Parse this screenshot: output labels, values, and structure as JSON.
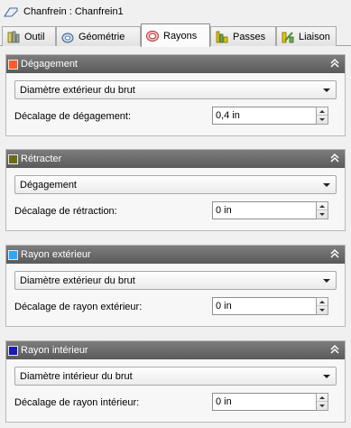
{
  "window": {
    "title": "Chanfrein : Chanfrein1",
    "icon": "chamfer-operation-icon"
  },
  "tabs": [
    {
      "label": "Outil",
      "icon": "tool-icon",
      "active": false
    },
    {
      "label": "Géométrie",
      "icon": "geometry-icon",
      "active": false
    },
    {
      "label": "Rayons",
      "icon": "radii-icon",
      "active": true
    },
    {
      "label": "Passes",
      "icon": "passes-icon",
      "active": false
    },
    {
      "label": "Liaison",
      "icon": "linking-icon",
      "active": false
    }
  ],
  "panels": [
    {
      "title": "Dégagement",
      "color": "#ff5a2a",
      "select_value": "Diamètre extérieur du brut",
      "field_label": "Décalage de dégagement:",
      "field_value": "0,4 in"
    },
    {
      "title": "Rétracter",
      "color": "#6b6b1a",
      "select_value": "Dégagement",
      "field_label": "Décalage de rétraction:",
      "field_value": "0 in"
    },
    {
      "title": "Rayon extérieur",
      "color": "#2aa8ff",
      "select_value": "Diamètre extérieur du brut",
      "field_label": "Décalage de rayon extérieur:",
      "field_value": "0 in"
    },
    {
      "title": "Rayon intérieur",
      "color": "#1a1ab4",
      "select_value": "Diamètre intérieur du brut",
      "field_label": "Décalage de rayon intérieur:",
      "field_value": "0 in"
    }
  ],
  "icons": {
    "collapse": "double-chevron-up-icon",
    "dropdown": "chevron-down-icon",
    "spin_up": "spin-up-icon",
    "spin_down": "spin-down-icon"
  }
}
